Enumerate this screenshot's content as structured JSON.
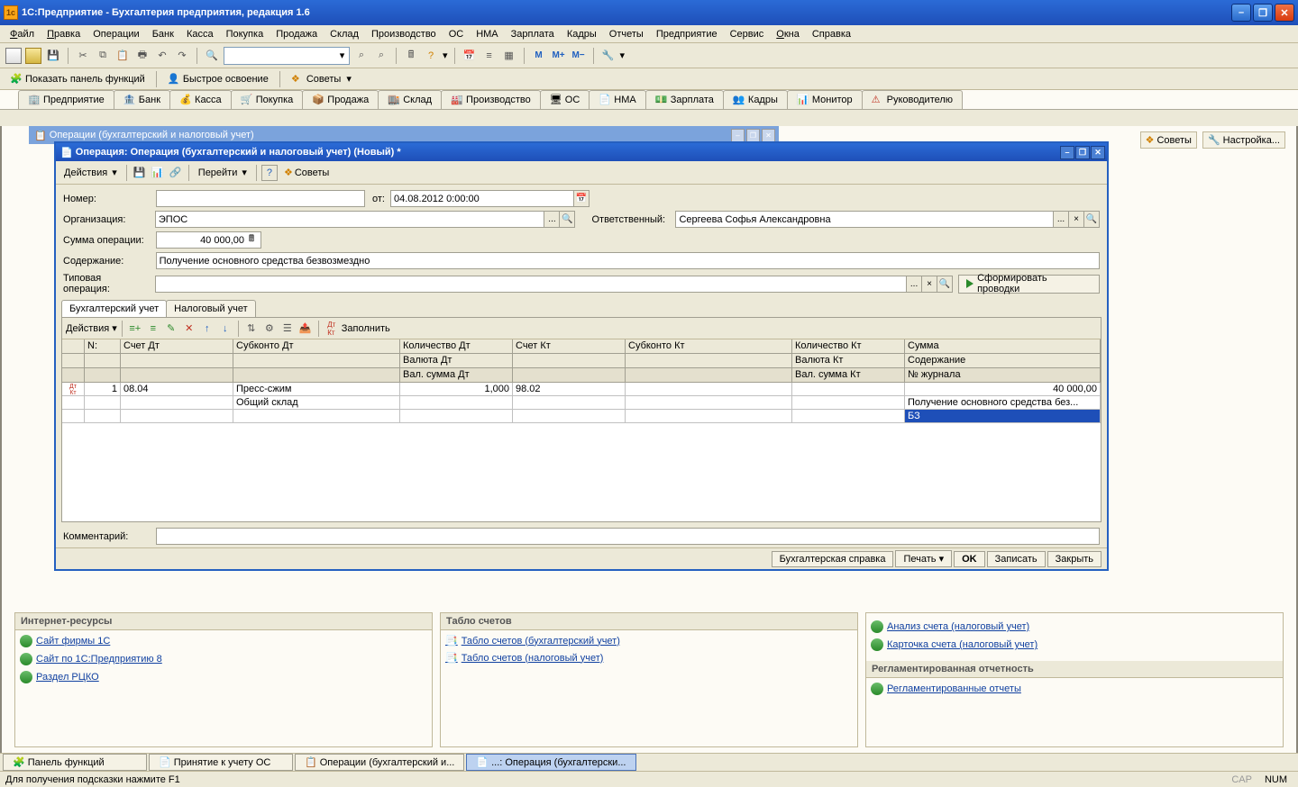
{
  "titlebar": {
    "title": "1С:Предприятие - Бухгалтерия предприятия, редакция 1.6"
  },
  "menu": {
    "items": [
      "Файл",
      "Правка",
      "Операции",
      "Банк",
      "Касса",
      "Покупка",
      "Продажа",
      "Склад",
      "Производство",
      "ОС",
      "НМА",
      "Зарплата",
      "Кадры",
      "Отчеты",
      "Предприятие",
      "Сервис",
      "Окна",
      "Справка"
    ]
  },
  "tb2": {
    "show_panel": "Показать панель функций",
    "quick": "Быстрое освоение",
    "tips": "Советы"
  },
  "navtabs": [
    "Предприятие",
    "Банк",
    "Касса",
    "Покупка",
    "Продажа",
    "Склад",
    "Производство",
    "ОС",
    "НМА",
    "Зарплата",
    "Кадры",
    "Монитор",
    "Руководителю"
  ],
  "rpanel": {
    "tips": "Советы",
    "settings": "Настройка..."
  },
  "bgwin": {
    "title": "Операции (бухгалтерский и налоговый учет)"
  },
  "dlg": {
    "title": "Операция: Операция (бухгалтерский и налоговый учет) (Новый) *",
    "actions": "Действия",
    "goto": "Перейти",
    "tips": "Советы",
    "number_lbl": "Номер:",
    "date_lbl": "от:",
    "date_val": "04.08.2012  0:00:00",
    "org_lbl": "Организация:",
    "org_val": "ЭПОС",
    "resp_lbl": "Ответственный:",
    "resp_val": "Сергеева Софья Александровна",
    "sum_lbl": "Сумма операции:",
    "sum_val": "40 000,00",
    "content_lbl": "Содержание:",
    "content_val": "Получение основного средства безвозмездно",
    "typical_lbl": "Типовая операция:",
    "generate": "Сформировать проводки",
    "tab1": "Бухгалтерский учет",
    "tab2": "Налоговый учет",
    "fill": "Заполнить",
    "grid_actions": "Действия",
    "headers": {
      "r1": [
        "N:",
        "Счет Дт",
        "Субконто Дт",
        "Количество Дт",
        "Счет Кт",
        "Субконто Кт",
        "Количество Кт",
        "Сумма"
      ],
      "r2": [
        "",
        "",
        "",
        "Валюта Дт",
        "",
        "",
        "Валюта Кт",
        "Содержание"
      ],
      "r3": [
        "",
        "",
        "",
        "Вал. сумма Дт",
        "",
        "",
        "Вал. сумма Кт",
        "№ журнала"
      ]
    },
    "row": {
      "n": "1",
      "dt": "08.04",
      "sub_dt": "Пресс-сжим",
      "qty_dt": "1,000",
      "kt": "98.02",
      "sub_kt": "",
      "qty_kt": "",
      "sum": "40 000,00",
      "sub2": "Общий склад",
      "content": "Получение основного средства без...",
      "journal": "БЗ"
    },
    "comment_lbl": "Комментарий:",
    "footer": {
      "ref": "Бухгалтерская справка",
      "print": "Печать",
      "ok": "OK",
      "write": "Записать",
      "close": "Закрыть"
    }
  },
  "panels": {
    "internet": {
      "title": "Интернет-ресурсы",
      "l1": "Сайт фирмы 1С",
      "l2": "Сайт по 1С:Предприятию 8",
      "l3": "Раздел РЦКО"
    },
    "tablo": {
      "title": "Табло счетов",
      "l1": "Табло счетов (бухгалтерский учет)",
      "l2": "Табло счетов (налоговый учет)"
    },
    "side": {
      "l1": "Анализ счета (налоговый учет)",
      "l2": "Карточка счета (налоговый учет)",
      "title2": "Регламентированная отчетность",
      "l3": "Регламентированные отчеты"
    }
  },
  "tasks": [
    "Панель функций",
    "Принятие к учету ОС",
    "Операции (бухгалтерский и...",
    "...: Операция (бухгалтерски..."
  ],
  "status": {
    "left": "Для получения подсказки нажмите F1",
    "cap": "CAP",
    "num": "NUM"
  }
}
